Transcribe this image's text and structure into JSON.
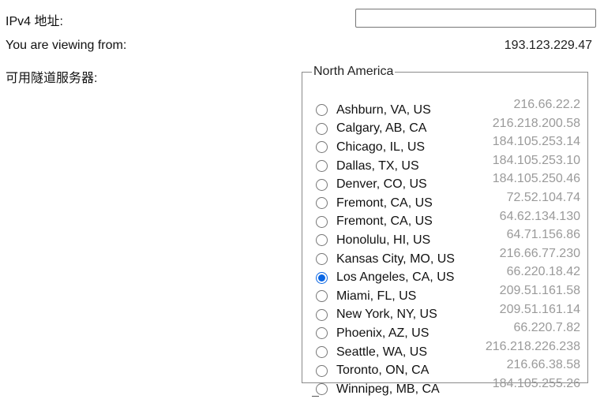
{
  "form": {
    "ipv4_label": "IPv4 地址:",
    "ipv4_value": "",
    "viewing_label": "You are viewing from:",
    "viewing_ip": "193.123.229.47",
    "servers_label": "可用隧道服务器:"
  },
  "region": {
    "name": "North America",
    "servers": [
      {
        "city": "Ashburn, VA, US",
        "ip": "216.66.22.2",
        "selected": false
      },
      {
        "city": "Calgary, AB, CA",
        "ip": "216.218.200.58",
        "selected": false
      },
      {
        "city": "Chicago, IL, US",
        "ip": "184.105.253.14",
        "selected": false
      },
      {
        "city": "Dallas, TX, US",
        "ip": "184.105.253.10",
        "selected": false
      },
      {
        "city": "Denver, CO, US",
        "ip": "184.105.250.46",
        "selected": false
      },
      {
        "city": "Fremont, CA, US",
        "ip": "72.52.104.74",
        "selected": false
      },
      {
        "city": "Fremont, CA, US",
        "ip": "64.62.134.130",
        "selected": false
      },
      {
        "city": "Honolulu, HI, US",
        "ip": "64.71.156.86",
        "selected": false
      },
      {
        "city": "Kansas City, MO, US",
        "ip": "216.66.77.230",
        "selected": false
      },
      {
        "city": "Los Angeles, CA, US",
        "ip": "66.220.18.42",
        "selected": true
      },
      {
        "city": "Miami, FL, US",
        "ip": "209.51.161.58",
        "selected": false
      },
      {
        "city": "New York, NY, US",
        "ip": "209.51.161.14",
        "selected": false
      },
      {
        "city": "Phoenix, AZ, US",
        "ip": "66.220.7.82",
        "selected": false
      },
      {
        "city": "Seattle, WA, US",
        "ip": "216.218.226.238",
        "selected": false
      },
      {
        "city": "Toronto, ON, CA",
        "ip": "216.66.38.58",
        "selected": false
      },
      {
        "city": "Winnipeg, MB, CA",
        "ip": "184.105.255.26",
        "selected": false
      }
    ]
  },
  "colors": {
    "selected_radio": "#0a66e4",
    "ip_text": "#9a9a9a"
  }
}
